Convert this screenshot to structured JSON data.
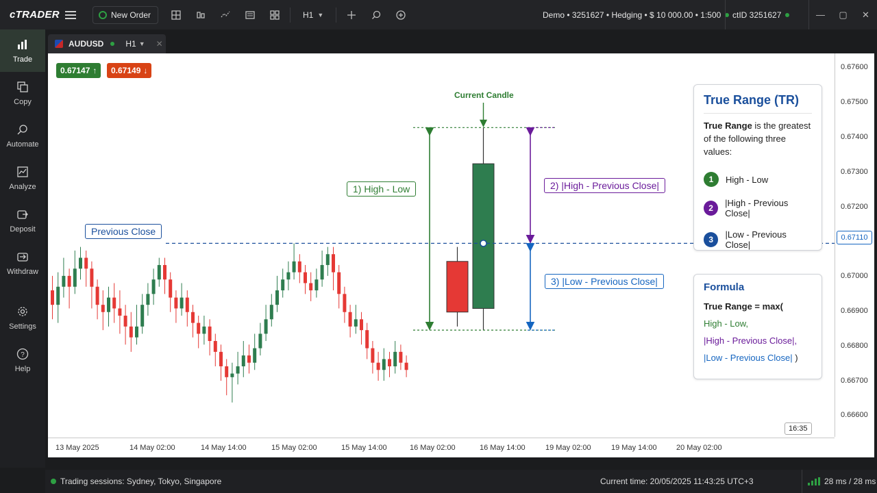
{
  "app": {
    "logo": "cTRADER"
  },
  "toolbar": {
    "new_order": "New Order",
    "timeframe": "H1"
  },
  "account": {
    "info": "Demo • 3251627 • Hedging • $ 10 000.00 • 1:500",
    "ctid": "ctID 3251627"
  },
  "sidebar": {
    "items": [
      {
        "label": "Trade",
        "icon": "trade-icon"
      },
      {
        "label": "Copy",
        "icon": "copy-icon"
      },
      {
        "label": "Automate",
        "icon": "automate-icon"
      },
      {
        "label": "Analyze",
        "icon": "analyze-icon"
      },
      {
        "label": "Deposit",
        "icon": "deposit-icon"
      },
      {
        "label": "Withdraw",
        "icon": "withdraw-icon"
      },
      {
        "label": "Settings",
        "icon": "gear-icon"
      },
      {
        "label": "Help",
        "icon": "help-icon"
      }
    ]
  },
  "tab": {
    "symbol": "AUDUSD",
    "timeframe": "H1"
  },
  "prices": {
    "bid": "0.67147",
    "ask": "0.67149",
    "current": "0.67110"
  },
  "price_axis": [
    "0.67600",
    "0.67500",
    "0.67400",
    "0.67300",
    "0.67200",
    "0.67000",
    "0.66900",
    "0.66800",
    "0.66700",
    "0.66600"
  ],
  "time_axis": [
    "13 May 2025",
    "14 May 02:00",
    "14 May 14:00",
    "15 May 02:00",
    "15 May 14:00",
    "16 May 02:00",
    "16 May 14:00",
    "19 May 02:00",
    "19 May 14:00",
    "20 May 02:00"
  ],
  "clock": "16:35",
  "annotations": {
    "previous_close": "Previous Close",
    "current_candle": "Current Candle",
    "high_low": "1) High - Low",
    "high_prev": "2) |High - Previous Close|",
    "low_prev": "3) |Low - Previous Close|"
  },
  "tr_box": {
    "title": "True Range (TR)",
    "desc_bold": "True Range",
    "desc_rest": " is the greatest of the following three values:",
    "items": [
      {
        "num": "1",
        "text": "High - Low",
        "color": "#2e7d32"
      },
      {
        "num": "2",
        "text": "|High - Previous Close|",
        "color": "#6a1b9a"
      },
      {
        "num": "3",
        "text": "|Low - Previous Close|",
        "color": "#1a4f9c"
      }
    ]
  },
  "formula_box": {
    "title": "Formula",
    "line1": "True Range = max(",
    "line2": "High - Low,",
    "line3": "|High - Previous Close|,",
    "line4_a": "|Low - Previous Close|",
    "line4_b": " )"
  },
  "status": {
    "sessions": "Trading sessions: Sydney, Tokyo, Singapore",
    "current_time": "Current time:  20/05/2025 11:43:25  UTC+3",
    "latency": "28 ms / 28 ms"
  },
  "chart_data": {
    "type": "candlestick",
    "symbol": "AUDUSD",
    "timeframe": "H1",
    "ylim": [
      0.66575,
      0.67635
    ],
    "previous_close": 0.6711,
    "candles": [
      [
        0.6698,
        0.6694,
        0.6702,
        0.669
      ],
      [
        0.6694,
        0.6699,
        0.6703,
        0.6689
      ],
      [
        0.6699,
        0.6702,
        0.6707,
        0.6696
      ],
      [
        0.6702,
        0.6699,
        0.6704,
        0.6693
      ],
      [
        0.6699,
        0.6704,
        0.6709,
        0.6697
      ],
      [
        0.6704,
        0.6707,
        0.671,
        0.6701
      ],
      [
        0.6707,
        0.6704,
        0.6709,
        0.6699
      ],
      [
        0.6704,
        0.6699,
        0.6706,
        0.6693
      ],
      [
        0.6699,
        0.6694,
        0.6701,
        0.669
      ],
      [
        0.6694,
        0.6692,
        0.6698,
        0.6687
      ],
      [
        0.6692,
        0.6696,
        0.6699,
        0.6688
      ],
      [
        0.6696,
        0.6693,
        0.67,
        0.6689
      ],
      [
        0.6693,
        0.6691,
        0.6698,
        0.6686
      ],
      [
        0.6691,
        0.6688,
        0.6694,
        0.6683
      ],
      [
        0.6688,
        0.6685,
        0.6692,
        0.6681
      ],
      [
        0.6685,
        0.6688,
        0.6694,
        0.6683
      ],
      [
        0.6688,
        0.6694,
        0.6697,
        0.6686
      ],
      [
        0.6694,
        0.6697,
        0.67,
        0.6691
      ],
      [
        0.6697,
        0.6701,
        0.6704,
        0.6694
      ],
      [
        0.6701,
        0.6705,
        0.6707,
        0.6699
      ],
      [
        0.6705,
        0.6701,
        0.6707,
        0.6697
      ],
      [
        0.6701,
        0.6696,
        0.6703,
        0.6692
      ],
      [
        0.6696,
        0.6693,
        0.6698,
        0.6689
      ],
      [
        0.6693,
        0.6696,
        0.67,
        0.6691
      ],
      [
        0.6696,
        0.6692,
        0.6698,
        0.6688
      ],
      [
        0.6692,
        0.6689,
        0.6694,
        0.6685
      ],
      [
        0.6689,
        0.6686,
        0.6691,
        0.6682
      ],
      [
        0.6686,
        0.6688,
        0.6691,
        0.6683
      ],
      [
        0.6688,
        0.6684,
        0.669,
        0.668
      ],
      [
        0.6684,
        0.6681,
        0.6686,
        0.6677
      ],
      [
        0.6681,
        0.6677,
        0.6683,
        0.6673
      ],
      [
        0.6677,
        0.6674,
        0.6679,
        0.6669
      ],
      [
        0.6674,
        0.6675,
        0.6678,
        0.6667
      ],
      [
        0.6675,
        0.6677,
        0.6681,
        0.6672
      ],
      [
        0.6677,
        0.668,
        0.6684,
        0.6674
      ],
      [
        0.668,
        0.6678,
        0.6683,
        0.6675
      ],
      [
        0.6678,
        0.6682,
        0.6686,
        0.6676
      ],
      [
        0.6682,
        0.6686,
        0.6689,
        0.668
      ],
      [
        0.6686,
        0.669,
        0.6694,
        0.6684
      ],
      [
        0.669,
        0.6694,
        0.6697,
        0.6688
      ],
      [
        0.6694,
        0.6698,
        0.6702,
        0.6692
      ],
      [
        0.6698,
        0.6701,
        0.6704,
        0.6696
      ],
      [
        0.6701,
        0.6703,
        0.6706,
        0.6698
      ],
      [
        0.6703,
        0.6706,
        0.6711,
        0.6701
      ],
      [
        0.6706,
        0.6703,
        0.6708,
        0.67
      ],
      [
        0.6703,
        0.67,
        0.6705,
        0.6697
      ],
      [
        0.67,
        0.6698,
        0.6703,
        0.6695
      ],
      [
        0.6698,
        0.6701,
        0.6704,
        0.6696
      ],
      [
        0.6701,
        0.6705,
        0.6709,
        0.6699
      ],
      [
        0.6705,
        0.6708,
        0.671,
        0.6702
      ],
      [
        0.6708,
        0.6703,
        0.671,
        0.6698
      ],
      [
        0.6703,
        0.6697,
        0.6705,
        0.6693
      ],
      [
        0.6697,
        0.6692,
        0.6699,
        0.6689
      ],
      [
        0.6692,
        0.6688,
        0.6694,
        0.6685
      ],
      [
        0.6688,
        0.669,
        0.6694,
        0.6686
      ],
      [
        0.669,
        0.6687,
        0.6692,
        0.6683
      ],
      [
        0.6687,
        0.6682,
        0.6689,
        0.6679
      ],
      [
        0.6682,
        0.6678,
        0.6684,
        0.6675
      ],
      [
        0.6678,
        0.6676,
        0.6681,
        0.6673
      ],
      [
        0.6676,
        0.6679,
        0.6682,
        0.6673
      ],
      [
        0.6679,
        0.6677,
        0.6681,
        0.6674
      ],
      [
        0.6677,
        0.6681,
        0.6684,
        0.6675
      ],
      [
        0.6681,
        0.6678,
        0.6683,
        0.6676
      ],
      [
        0.6678,
        0.6676,
        0.668,
        0.6674
      ]
    ],
    "current_candles": [
      {
        "label": "previous",
        "open": 0.6706,
        "close": 0.6692,
        "high": 0.671,
        "low": 0.6688
      },
      {
        "label": "current",
        "open": 0.6693,
        "close": 0.6733,
        "high": 0.6743,
        "low": 0.6687
      }
    ],
    "colors": {
      "up": "#2e7d4f",
      "down": "#e53935"
    }
  }
}
